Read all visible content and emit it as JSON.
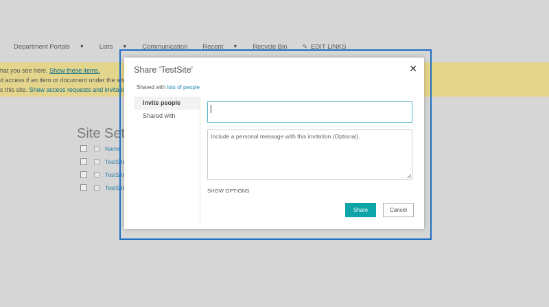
{
  "nav": {
    "items": [
      {
        "label": "Department Portals",
        "has_dropdown": true
      },
      {
        "label": "Lists",
        "has_dropdown": true
      },
      {
        "label": "Communication",
        "has_dropdown": false
      },
      {
        "label": "Recent",
        "has_dropdown": true
      },
      {
        "label": "Recycle Bin",
        "has_dropdown": false
      }
    ],
    "edit_links": "EDIT LINKS"
  },
  "banner": {
    "line1_text": "hat you see here.",
    "line1_link": "Show these items.",
    "line2_text": "d access if an item or document under the site",
    "line3_text": "s this site.",
    "line3_link": "Show access requests and invitatio"
  },
  "background": {
    "site_title": "Site Sett",
    "column_name": "Name",
    "rows": [
      "TestSite",
      "TestSite",
      "TestSite"
    ]
  },
  "dialog": {
    "title": "Share 'TestSite'",
    "close_glyph": "✕",
    "shared_prefix": "Shared with",
    "shared_link": "lots of people",
    "tabs": [
      {
        "label": "Invite people",
        "active": true
      },
      {
        "label": "Shared with",
        "active": false
      }
    ],
    "people_input_value": "",
    "message_placeholder": "Include a personal message with this invitation (Optional).",
    "show_options": "SHOW OPTIONS",
    "share_label": "Share",
    "cancel_label": "Cancel"
  },
  "colors": {
    "accent": "#0ea4a8",
    "link": "#1f87b5",
    "banner": "#e3d58c",
    "focus_frame": "#1d6fc4"
  }
}
